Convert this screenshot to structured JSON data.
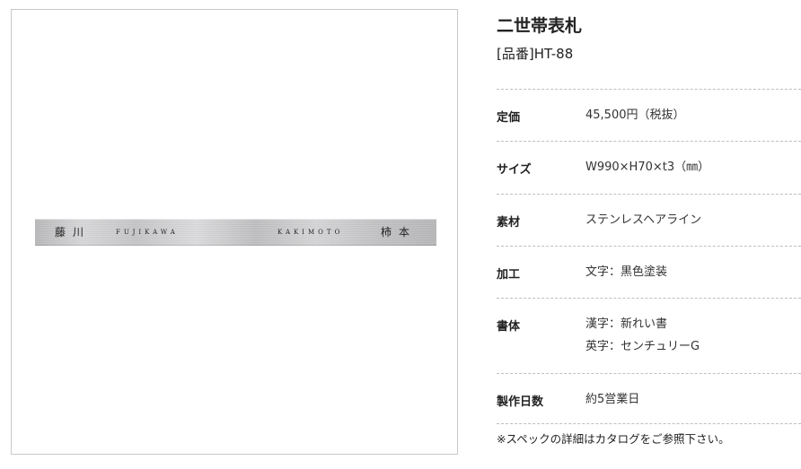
{
  "product": {
    "title": "二世帯表札",
    "code": "[品番]HT-88"
  },
  "nameplate": {
    "left_kanji": "藤川",
    "left_roman": "FUJIKAWA",
    "right_roman": "KAKIMOTO",
    "right_kanji": "柿本",
    "finish": "stainless-hairline"
  },
  "specs": [
    {
      "label": "定価",
      "values": [
        "45,500円（税抜）"
      ]
    },
    {
      "label": "サイズ",
      "values": [
        "W990×H70×t3（㎜）"
      ]
    },
    {
      "label": "素材",
      "values": [
        "ステンレスヘアライン"
      ]
    },
    {
      "label": "加工",
      "values": [
        "文字：黒色塗装"
      ]
    },
    {
      "label": "書体",
      "values": [
        "漢字：新れい書",
        "英字：センチュリーG"
      ]
    },
    {
      "label": "製作日数",
      "values": [
        "約5営業日"
      ]
    }
  ],
  "note": "※スペックの詳細はカタログをご参照下さい。"
}
